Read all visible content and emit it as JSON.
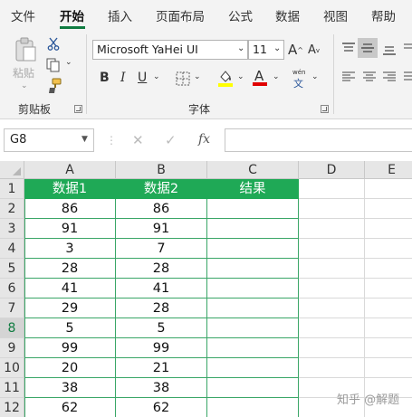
{
  "menu": {
    "tabs": [
      "文件",
      "开始",
      "插入",
      "页面布局",
      "公式",
      "数据",
      "视图",
      "帮助"
    ],
    "active_tab": "开始"
  },
  "ribbon": {
    "clipboard": {
      "paste_label": "粘贴",
      "group_label": "剪贴板"
    },
    "font": {
      "font_name": "Microsoft YaHei UI",
      "font_size": "11",
      "bold": "B",
      "italic": "I",
      "underline": "U",
      "group_label": "字体",
      "phonetic_top": "wén",
      "phonetic_bottom": "文"
    }
  },
  "formula_bar": {
    "name_box": "G8",
    "fx": "fx",
    "formula": ""
  },
  "grid": {
    "columns": [
      "A",
      "B",
      "C",
      "D",
      "E"
    ],
    "rows": [
      "1",
      "2",
      "3",
      "4",
      "5",
      "6",
      "7",
      "8",
      "9",
      "10",
      "11",
      "12"
    ],
    "selected_row": "8",
    "header": [
      "数据1",
      "数据2",
      "结果"
    ],
    "data": [
      [
        "86",
        "86",
        ""
      ],
      [
        "91",
        "91",
        ""
      ],
      [
        "3",
        "7",
        ""
      ],
      [
        "28",
        "28",
        ""
      ],
      [
        "41",
        "41",
        ""
      ],
      [
        "29",
        "28",
        ""
      ],
      [
        "5",
        "5",
        ""
      ],
      [
        "99",
        "99",
        ""
      ],
      [
        "20",
        "21",
        ""
      ],
      [
        "38",
        "38",
        ""
      ],
      [
        "62",
        "62",
        ""
      ]
    ]
  },
  "colors": {
    "accent": "#107c41",
    "header_fill": "#1fa956"
  },
  "watermark": "知乎 @解题"
}
